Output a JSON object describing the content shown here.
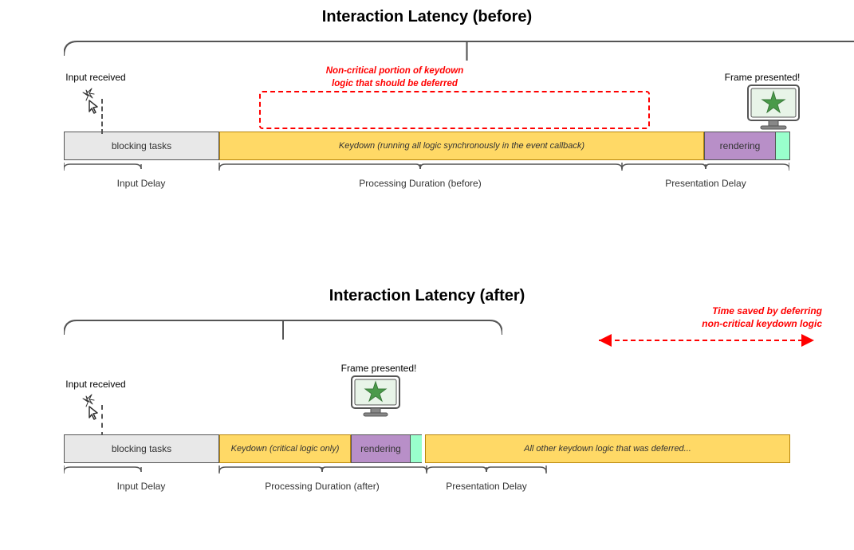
{
  "top": {
    "title": "Interaction Latency (before)",
    "label_input_received": "Input received",
    "label_frame_presented": "Frame presented!",
    "annotation_text": "Non-critical portion of keydown\nlogic that should be deferred",
    "bar_blocking": "blocking tasks",
    "bar_keydown": "Keydown (running all logic synchronously in the event callback)",
    "bar_rendering": "rendering",
    "label_input_delay": "Input Delay",
    "label_processing": "Processing Duration (before)",
    "label_presentation": "Presentation Delay"
  },
  "bottom": {
    "title": "Interaction Latency (after)",
    "arrow_text": "Time saved by deferring\nnon-critical keydown logic",
    "label_input_received": "Input received",
    "label_frame_presented": "Frame presented!",
    "bar_blocking": "blocking tasks",
    "bar_keydown": "Keydown (critical logic only)",
    "bar_rendering": "rendering",
    "bar_deferred": "All other keydown logic that was deferred...",
    "label_input_delay": "Input Delay",
    "label_processing": "Processing Duration (after)",
    "label_presentation": "Presentation Delay"
  },
  "colors": {
    "blocking_bg": "#e8e8e8",
    "keydown_bg": "#ffd966",
    "rendering_bg": "#9fc",
    "render_purple": "#b88fc8",
    "red": "#dd0000"
  }
}
